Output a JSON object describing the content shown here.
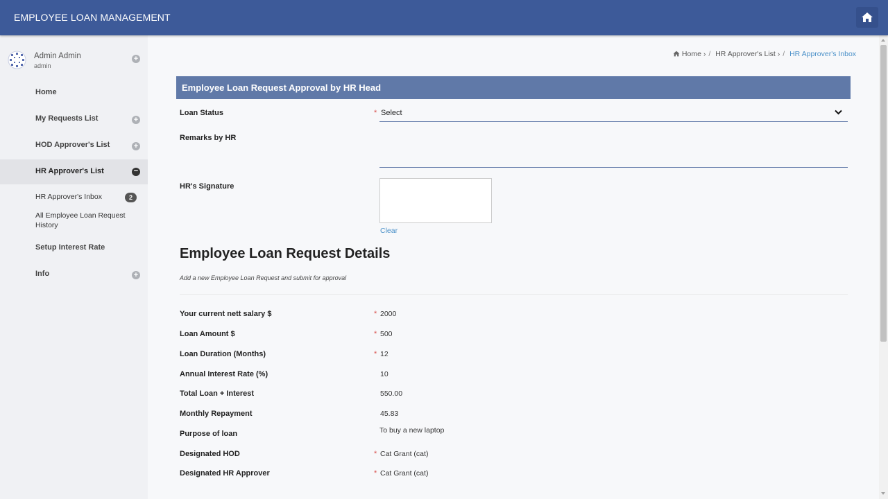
{
  "app": {
    "title": "EMPLOYEE LOAN MANAGEMENT"
  },
  "user": {
    "name": "Admin Admin",
    "role": "admin"
  },
  "nav": {
    "home": "Home",
    "my_requests": "My Requests List",
    "hod_approvers": "HOD Approver's List",
    "hr_approvers": "HR Approver's List",
    "hr_inbox": "HR Approver's Inbox",
    "hr_inbox_count": "2",
    "all_history": "All Employee Loan Request History",
    "setup_interest": "Setup Interest Rate",
    "info": "Info"
  },
  "breadcrumb": {
    "home": "Home",
    "hr_list": "HR Approver's List",
    "current": "HR Approver's Inbox",
    "sep": "/"
  },
  "approval": {
    "header": "Employee Loan Request Approval by HR Head",
    "loan_status_label": "Loan Status",
    "loan_status_value": "Select",
    "remarks_label": "Remarks by HR",
    "remarks_value": "",
    "signature_label": "HR's Signature",
    "clear_label": "Clear"
  },
  "details": {
    "title": "Employee Loan Request Details",
    "subtitle": "Add a new Employee Loan Request and submit for approval",
    "fields": [
      {
        "label": "Your current nett salary $",
        "value": "2000",
        "required": true
      },
      {
        "label": "Loan Amount $",
        "value": "500",
        "required": true
      },
      {
        "label": "Loan Duration (Months)",
        "value": "12",
        "required": true
      },
      {
        "label": "Annual Interest Rate (%)",
        "value": "10",
        "required": false
      },
      {
        "label": "Total Loan + Interest",
        "value": "550.00",
        "required": false
      },
      {
        "label": "Monthly Repayment",
        "value": "45.83",
        "required": false
      },
      {
        "label": "Purpose of loan",
        "value": "To buy a new laptop",
        "required": false
      },
      {
        "label": "Designated HOD",
        "value": "Cat Grant (cat)",
        "required": true
      },
      {
        "label": "Designated HR Approver",
        "value": "Cat Grant (cat)",
        "required": true
      }
    ]
  },
  "colors": {
    "topbar": "#3d5a99",
    "panel_header": "#6079a8",
    "link": "#4a90c8",
    "required": "#d9534f",
    "sidebar": "#f0f1f4"
  },
  "icons": {
    "home": "home-icon",
    "expand": "plus-circle-icon",
    "collapse": "minus-circle-icon",
    "dropdown": "chevron-down-icon"
  }
}
